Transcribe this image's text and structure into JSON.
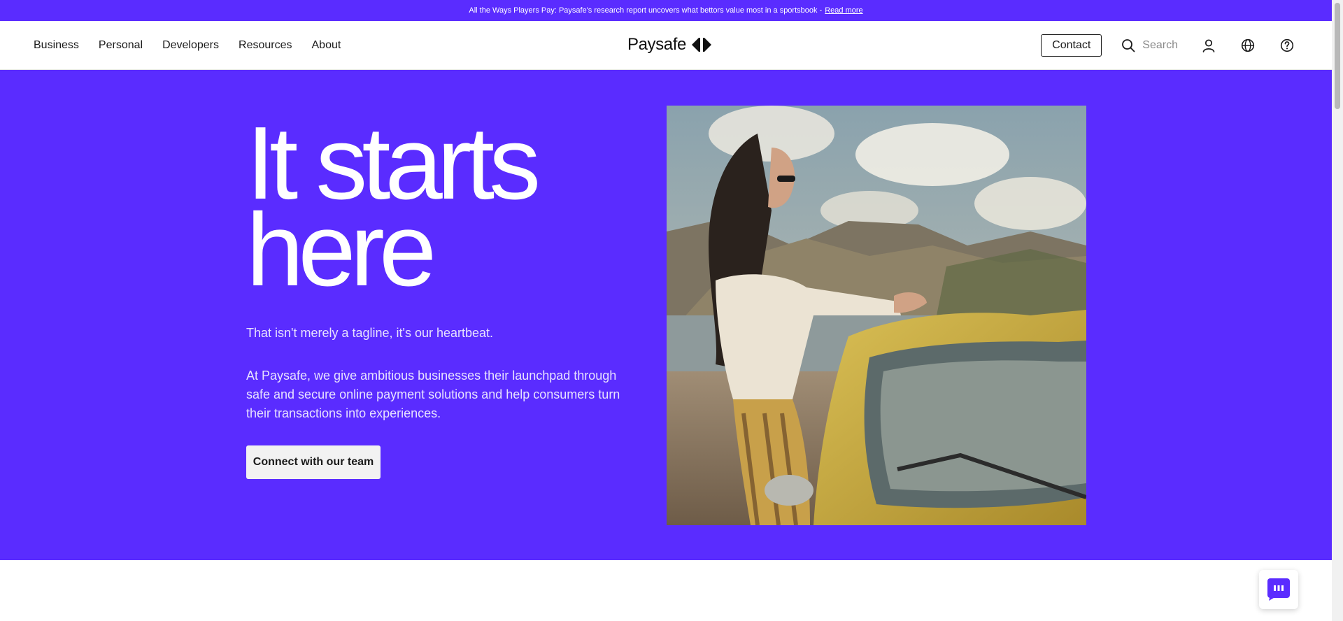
{
  "announcement": {
    "text": "All the Ways Players Pay: Paysafe's research report uncovers what bettors value most in a sportsbook -",
    "link_label": "Read more"
  },
  "nav": {
    "items": [
      {
        "label": "Business"
      },
      {
        "label": "Personal"
      },
      {
        "label": "Developers"
      },
      {
        "label": "Resources"
      },
      {
        "label": "About"
      }
    ],
    "logo_text": "Paysafe",
    "contact_label": "Contact",
    "search_label": "Search",
    "icons": [
      "search-icon",
      "user-icon",
      "globe-icon",
      "help-icon"
    ]
  },
  "hero": {
    "headline_line1": "It starts",
    "headline_line2": "here",
    "tagline": "That isn't merely a tagline, it's our heartbeat.",
    "description": "At Paysafe, we give ambitious businesses their launchpad through safe and secure online payment solutions and help consumers turn their transactions into experiences.",
    "cta_label": "Connect with our team"
  },
  "colors": {
    "brand_purple": "#5a2cff",
    "hero_text": "#ffffff",
    "secondary_text": "#e7e1ff"
  }
}
